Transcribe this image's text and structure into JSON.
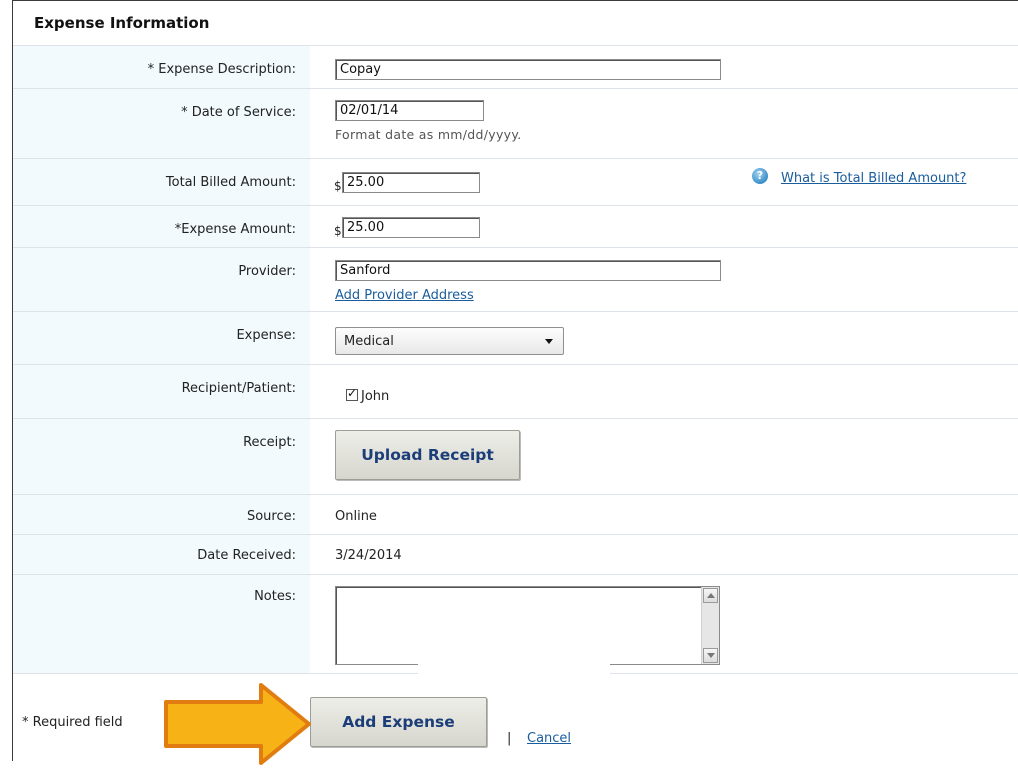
{
  "section_title": "Expense Information",
  "form": {
    "description": {
      "label": "* Expense Description:",
      "value": "Copay"
    },
    "date_of_service": {
      "label": "* Date of Service:",
      "value": "02/01/14",
      "hint": "Format date as mm/dd/yyyy."
    },
    "total_billed": {
      "label": "Total Billed Amount:",
      "currency": "$",
      "value": "25.00",
      "help_link": "What is Total Billed Amount?"
    },
    "expense_amount": {
      "label": "*Expense Amount:",
      "currency": "$",
      "value": "25.00"
    },
    "provider": {
      "label": "Provider:",
      "value": "Sanford",
      "link": "Add Provider Address"
    },
    "expense": {
      "label": "Expense:",
      "selected": "Medical"
    },
    "recipient": {
      "label": "Recipient/Patient:",
      "checkbox_label": "John",
      "checked": true
    },
    "receipt": {
      "label": "Receipt:",
      "button": "Upload Receipt"
    },
    "source": {
      "label": "Source:",
      "value": "Online"
    },
    "date_received": {
      "label": "Date Received:",
      "value": "3/24/2014"
    },
    "notes": {
      "label": "Notes:",
      "value": ""
    }
  },
  "footer": {
    "required_note": "* Required field",
    "add_button": "Add Expense",
    "separator": "|",
    "cancel": "Cancel"
  },
  "colors": {
    "label_bg": "#f2fafd",
    "link": "#1a5d9c",
    "button_text": "#1b3d78",
    "arrow_fill": "#f7b316",
    "arrow_stroke": "#e07c10"
  },
  "icons": {
    "help": "question-globe-icon",
    "callout": "arrow-right-icon"
  }
}
